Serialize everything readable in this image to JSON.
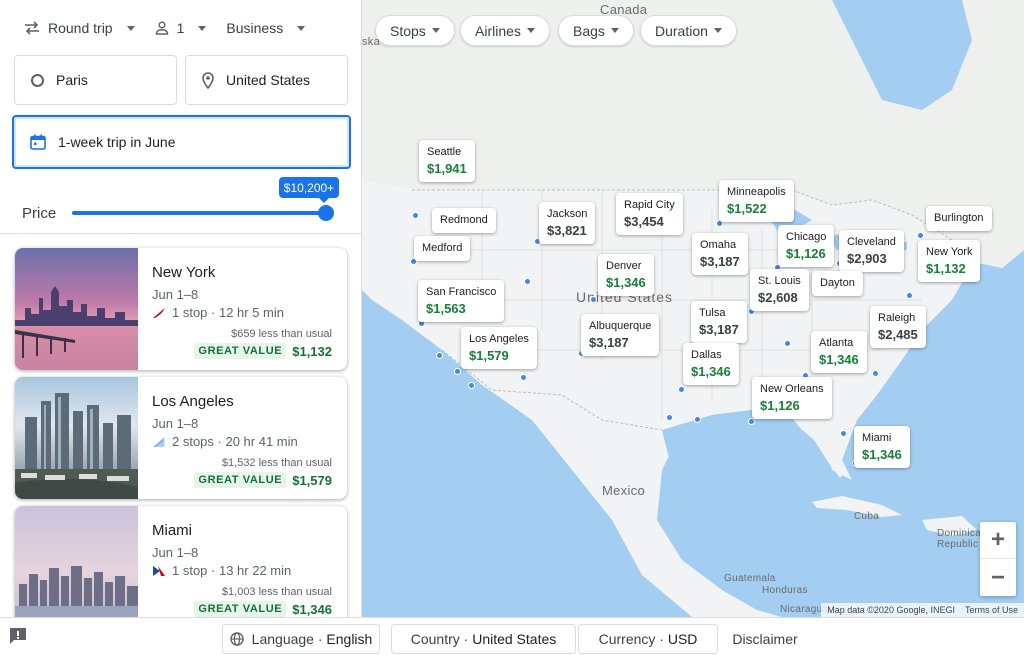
{
  "options": {
    "trip_type": "Round trip",
    "passengers": "1",
    "cabin_class": "Business"
  },
  "search": {
    "origin": "Paris",
    "destination": "United States",
    "dates": "1-week trip in June"
  },
  "price_filter": {
    "label": "Price",
    "max_value": "$10,200+",
    "slider_level": 1.0
  },
  "results": [
    {
      "city": "New York",
      "dates": "Jun 1–8",
      "flight": "1 stop · 12 hr 5 min",
      "savings": "$659 less than usual",
      "badge": "GREAT VALUE",
      "price": "$1,132",
      "airline_color": "#d0021b"
    },
    {
      "city": "Los Angeles",
      "dates": "Jun 1–8",
      "flight": "2 stops · 20 hr 41 min",
      "savings": "$1,532 less than usual",
      "badge": "GREAT VALUE",
      "price": "$1,579",
      "airline_color": "#7baaf7"
    },
    {
      "city": "Miami",
      "dates": "Jun 1–8",
      "flight": "1 stop · 13 hr 22 min",
      "savings": "$1,003 less than usual",
      "badge": "GREAT VALUE",
      "price": "$1,346",
      "airline_color": "#1a4c9e"
    }
  ],
  "map_filters": [
    "Stops",
    "Airlines",
    "Bags",
    "Duration"
  ],
  "map_labels": {
    "canada": "Canada",
    "united_states": "United States",
    "mexico": "Mexico",
    "cuba": "Cuba",
    "guatemala": "Guatemala",
    "honduras": "Honduras",
    "nicaragua": "Nicaragua",
    "dominican": "Dominican Republic",
    "cut_label": "ska"
  },
  "map_pins": [
    {
      "city": "Seattle",
      "price": "$1,941",
      "highlight": true
    },
    {
      "city": "Redmond",
      "price": "",
      "highlight": false
    },
    {
      "city": "Medford",
      "price": "",
      "highlight": false
    },
    {
      "city": "Jackson",
      "price": "$3,821",
      "highlight": false
    },
    {
      "city": "Rapid City",
      "price": "$3,454",
      "highlight": false
    },
    {
      "city": "Minneapolis",
      "price": "$1,522",
      "highlight": true
    },
    {
      "city": "Burlington",
      "price": "",
      "highlight": false
    },
    {
      "city": "Chicago",
      "price": "$1,126",
      "highlight": true
    },
    {
      "city": "Cleveland",
      "price": "$2,903",
      "highlight": false
    },
    {
      "city": "New York",
      "price": "$1,132",
      "highlight": true
    },
    {
      "city": "Omaha",
      "price": "$3,187",
      "highlight": false
    },
    {
      "city": "Denver",
      "price": "$1,346",
      "highlight": true
    },
    {
      "city": "St. Louis",
      "price": "$2,608",
      "highlight": false
    },
    {
      "city": "Dayton",
      "price": "",
      "highlight": false
    },
    {
      "city": "San Francisco",
      "price": "$1,563",
      "highlight": true
    },
    {
      "city": "Tulsa",
      "price": "$3,187",
      "highlight": false
    },
    {
      "city": "Raleigh",
      "price": "$2,485",
      "highlight": false
    },
    {
      "city": "Albuquerque",
      "price": "$3,187",
      "highlight": false
    },
    {
      "city": "Los Angeles",
      "price": "$1,579",
      "highlight": true
    },
    {
      "city": "Atlanta",
      "price": "$1,346",
      "highlight": true
    },
    {
      "city": "Dallas",
      "price": "$1,346",
      "highlight": true
    },
    {
      "city": "New Orleans",
      "price": "$1,126",
      "highlight": true
    },
    {
      "city": "Miami",
      "price": "$1,346",
      "highlight": true
    }
  ],
  "map_controls": {
    "zoom_in": "+",
    "zoom_out": "−"
  },
  "attribution": {
    "data": "Map data ©2020 Google, INEGI",
    "terms": "Terms of Use"
  },
  "footer": {
    "language_label": "Language · ",
    "language_value": "English",
    "country_label": "Country · ",
    "country_value": "United States",
    "currency_label": "Currency · ",
    "currency_value": "USD",
    "disclaimer": "Disclaimer"
  }
}
